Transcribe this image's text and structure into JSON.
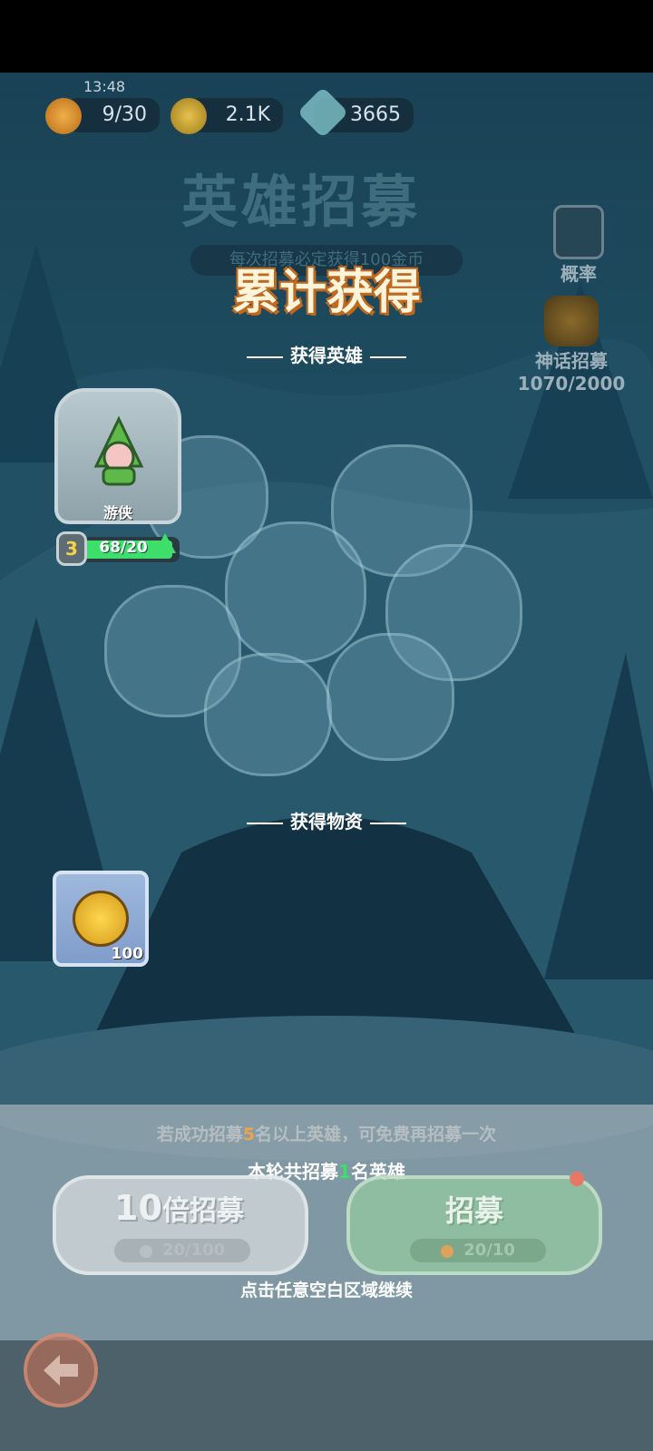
{
  "status": {
    "time": "13:48"
  },
  "resources": [
    {
      "icon": "flame-energy-icon",
      "value": "9/30"
    },
    {
      "icon": "gold-coin-icon",
      "value": "2.1K"
    },
    {
      "icon": "crystal-gem-icon",
      "value": "3665"
    }
  ],
  "page": {
    "title": "英雄招募",
    "subtitle": "每次招募必定获得100金币"
  },
  "sidebar": {
    "probability_label": "概率",
    "mythic_label": "神话招募",
    "mythic_progress": "1070/2000"
  },
  "overlay": {
    "title": "累计获得",
    "heroes_section": "获得英雄",
    "items_section": "获得物资"
  },
  "hero_card": {
    "name": "游侠",
    "level": "3",
    "shards": "68/20",
    "shard_fraction": 1.0
  },
  "item_card": {
    "icon": "gold-coin-icon",
    "count": "100"
  },
  "footer": {
    "bonus_hint_pre": "若成功招募",
    "bonus_hint_num": "5",
    "bonus_hint_post": "名以上英雄，可免费再招募一次",
    "round_pre": "本轮共招募",
    "round_num": "1",
    "round_post": "名英雄",
    "ten_pull_num": "10",
    "ten_pull_label": "倍招募",
    "ten_pull_cost": "20/100",
    "pull_label": "招募",
    "pull_cost": "20/10",
    "continue_hint": "点击任意空白区域继续"
  },
  "colors": {
    "title_orange": "#f7a233",
    "accent_green": "#3ddf6a",
    "highlight_yellow": "#f2d34a"
  }
}
